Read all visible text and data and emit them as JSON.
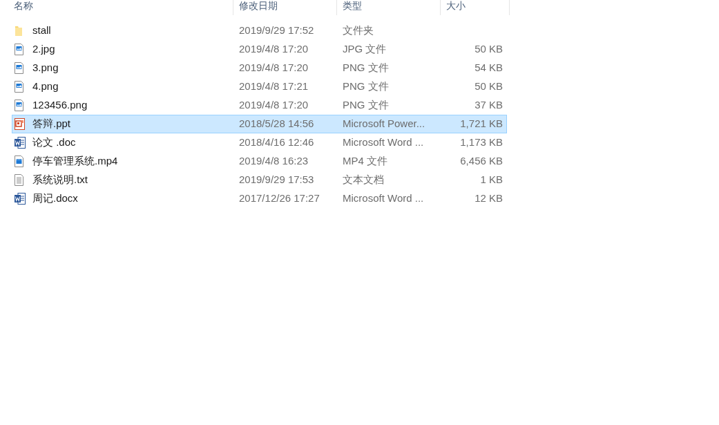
{
  "table": {
    "columns": [
      "名称",
      "修改日期",
      "类型",
      "大小"
    ],
    "rows": [
      {
        "kind": "folder",
        "name": "stall",
        "date": "2019/9/29 17:52",
        "type": "文件夹",
        "selected": false
      },
      {
        "kind": "image",
        "name": "2.jpg",
        "date": "2019/4/8 17:20",
        "type": "JPG 文件",
        "size": "50 KB",
        "selected": false
      },
      {
        "kind": "image",
        "name": "3.png",
        "date": "2019/4/8 17:20",
        "type": "PNG 文件",
        "size": "54 KB",
        "selected": false
      },
      {
        "kind": "image",
        "name": "4.png",
        "date": "2019/4/8 17:21",
        "type": "PNG 文件",
        "size": "50 KB",
        "selected": false
      },
      {
        "kind": "image",
        "name": "123456.png",
        "date": "2019/4/8 17:20",
        "type": "PNG 文件",
        "size": "37 KB",
        "selected": false
      },
      {
        "kind": "ppt",
        "name": "答辩.ppt",
        "date": "2018/5/28 14:56",
        "type": "Microsoft Power...",
        "size": "1,721 KB",
        "selected": true
      },
      {
        "kind": "word",
        "name": "论文 .doc",
        "date": "2018/4/16 12:46",
        "type": "Microsoft Word ...",
        "size": "1,173 KB",
        "selected": false
      },
      {
        "kind": "video",
        "name": "停车管理系统.mp4",
        "date": "2019/4/8 16:23",
        "type": "MP4 文件",
        "size": "6,456 KB",
        "selected": false
      },
      {
        "kind": "text",
        "name": "系统说明.txt",
        "date": "2019/9/29 17:53",
        "type": "文本文档",
        "size": "1 KB",
        "selected": false
      },
      {
        "kind": "word",
        "name": "周记.docx",
        "date": "2017/12/26 17:27",
        "type": "Microsoft Word ...",
        "size": "12 KB",
        "selected": false
      }
    ]
  }
}
